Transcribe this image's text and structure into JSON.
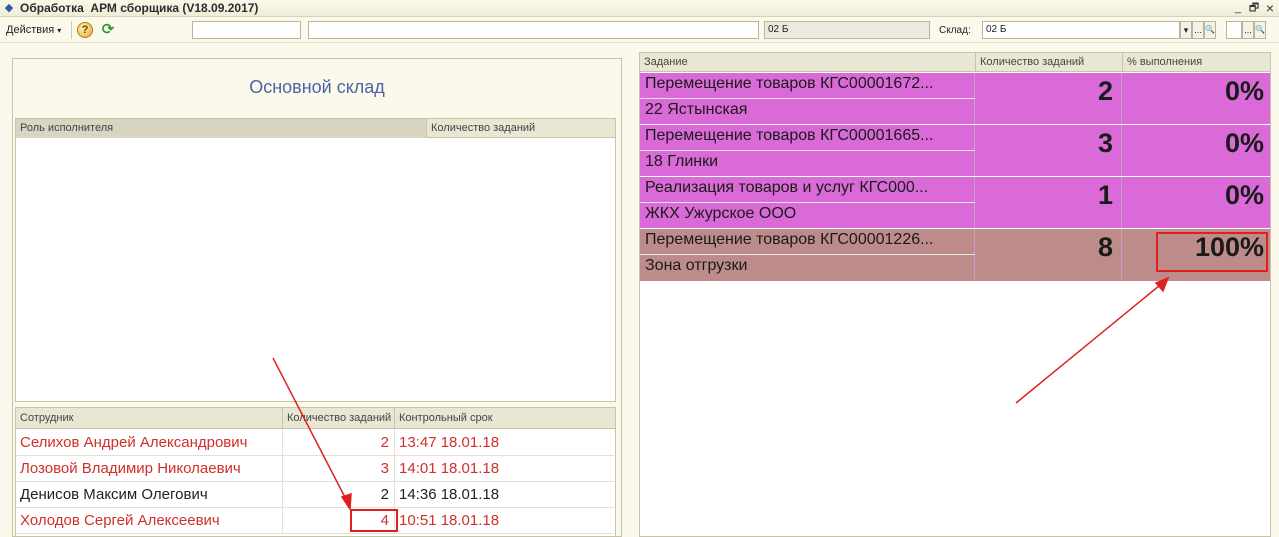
{
  "window": {
    "title": "Обработка  АРМ сборщика (V18.09.2017)",
    "minimize_icon": "_",
    "restore_icon": "🗗",
    "close_icon": "×"
  },
  "toolbar": {
    "actions_label": "Действия",
    "help_icon": "?",
    "refresh_icon": "⟳",
    "field1_value": "",
    "field2_value": "",
    "field3_value": "02 Б",
    "warehouse_label": "Склад:",
    "warehouse_value": "02 Б",
    "dropdown_icon": "▾",
    "ellipsis_icon": "...",
    "search_icon": "🔍",
    "field4_value": ""
  },
  "left": {
    "warehouse_title": "Основной склад",
    "roles_grid": {
      "col_role": "Роль исполнителя",
      "col_count": "Количество заданий",
      "rows": []
    },
    "employees_grid": {
      "col_employee": "Сотрудник",
      "col_count": "Количество заданий",
      "col_deadline": "Контрольный срок",
      "rows": [
        {
          "name": "Селихов Андрей Александрович",
          "count": "2",
          "deadline": "13:47  18.01.18",
          "color": "#d0302a"
        },
        {
          "name": "Лозовой Владимир Николаевич",
          "count": "3",
          "deadline": "14:01  18.01.18",
          "color": "#d0302a"
        },
        {
          "name": "Денисов Максим Олегович",
          "count": "2",
          "deadline": "14:36  18.01.18",
          "color": "#222222"
        },
        {
          "name": "Холодов Сергей Алексеевич",
          "count": "4",
          "deadline": "10:51  18.01.18",
          "color": "#d0302a"
        }
      ]
    }
  },
  "right": {
    "col_task": "Задание",
    "col_count": "Количество заданий",
    "col_percent": "% выполнения",
    "tasks": [
      {
        "title": "Перемещение товаров КГС00001672...",
        "subtitle": "22 Ястынская",
        "count": "2",
        "percent": "0%",
        "color": "#d96ad7"
      },
      {
        "title": "Перемещение товаров КГС00001665...",
        "subtitle": "18 Глинки",
        "count": "3",
        "percent": "0%",
        "color": "#d96ad7"
      },
      {
        "title": "Реализация товаров и услуг КГС000...",
        "subtitle": "ЖКХ Ужурское ООО",
        "count": "1",
        "percent": "0%",
        "color": "#d96ad7"
      },
      {
        "title": "Перемещение товаров КГС00001226...",
        "subtitle": "Зона отгрузки",
        "count": "8",
        "percent": "100%",
        "color": "#bd8c8a"
      }
    ]
  },
  "annotation_color": "#e02020"
}
